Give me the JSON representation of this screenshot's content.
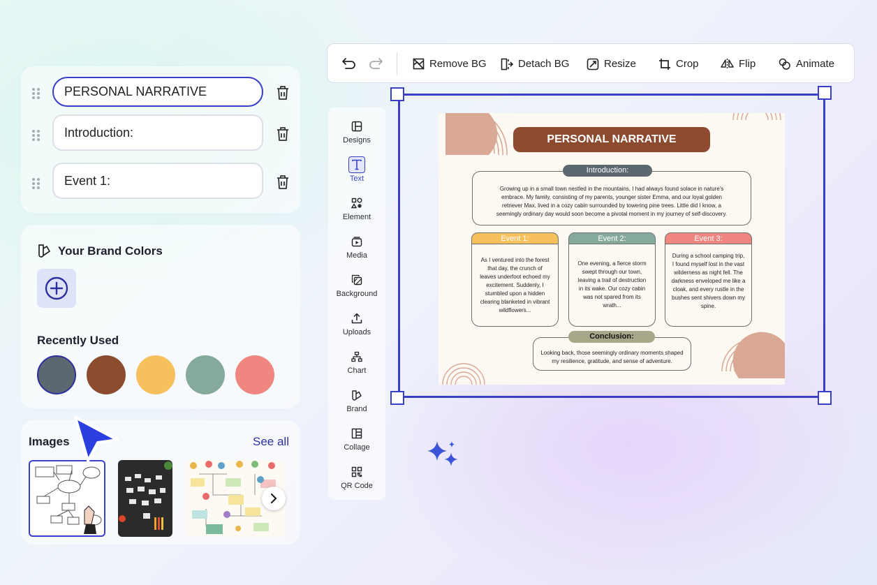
{
  "outline": {
    "items": [
      {
        "value": "PERSONAL NARRATIVE"
      },
      {
        "value": "Introduction:"
      },
      {
        "value": "Event 1:"
      }
    ]
  },
  "brand": {
    "title": "Your Brand Colors",
    "recent_title": "Recently Used",
    "recent_colors": [
      "#5d6770",
      "#8b4c2f",
      "#f6c05c",
      "#85aa9b",
      "#f08680"
    ]
  },
  "images": {
    "title": "Images",
    "see_all": "See all"
  },
  "toolbar": {
    "remove_bg": "Remove BG",
    "detach_bg": "Detach BG",
    "resize": "Resize",
    "crop": "Crop",
    "flip": "Flip",
    "animate": "Animate"
  },
  "side_menu": {
    "items": [
      {
        "label": "Designs",
        "icon": "designs-icon"
      },
      {
        "label": "Text",
        "icon": "text-icon"
      },
      {
        "label": "Element",
        "icon": "element-icon"
      },
      {
        "label": "Media",
        "icon": "media-icon"
      },
      {
        "label": "Background",
        "icon": "background-icon"
      },
      {
        "label": "Uploads",
        "icon": "uploads-icon"
      },
      {
        "label": "Chart",
        "icon": "chart-icon"
      },
      {
        "label": "Brand",
        "icon": "brand-icon"
      },
      {
        "label": "Collage",
        "icon": "collage-icon"
      },
      {
        "label": "QR Code",
        "icon": "qr-code-icon"
      }
    ],
    "active": "Text"
  },
  "design": {
    "title": "PERSONAL NARRATIVE",
    "intro_label": "Introduction:",
    "intro_text": "Growing up in a small town nestled in the mountains, I had always found solace in nature's embrace. My family, consisting of my parents, younger sister Emma, and our loyal golden retriever Max, lived in a cozy cabin surrounded by towering pine trees. Little did I know, a seemingly ordinary day would soon become a pivotal moment in my journey of self-discovery.",
    "events": [
      {
        "label": "Event 1:",
        "color": "#f6c05c",
        "text": "As I ventured into the forest that day, the crunch of leaves underfoot echoed my excitement. Suddenly, I stumbled upon a hidden clearing blanketed in vibrant wildflowers..."
      },
      {
        "label": "Event 2:",
        "color": "#85aa9b",
        "text": "One evening, a fierce storm swept through our town, leaving a trail of destruction in its wake. Our cozy cabin was not spared from its wrath..."
      },
      {
        "label": "Event 3:",
        "color": "#f08680",
        "text": "During a school camping trip, I found myself lost in the vast wilderness as night fell. The darkness enveloped me like a cloak, and every rustle in the bushes sent shivers down my spine."
      }
    ],
    "conclusion_label": "Conclusion:",
    "conclusion_text": "Looking back, those seemingly ordinary moments shaped my resilience, gratitude, and sense of adventure."
  },
  "colors": {
    "accent": "#3a3fc8",
    "title_brown": "#8c4a2f",
    "intro_gray": "#5d6770",
    "conclusion_olive": "#a7a88a"
  }
}
